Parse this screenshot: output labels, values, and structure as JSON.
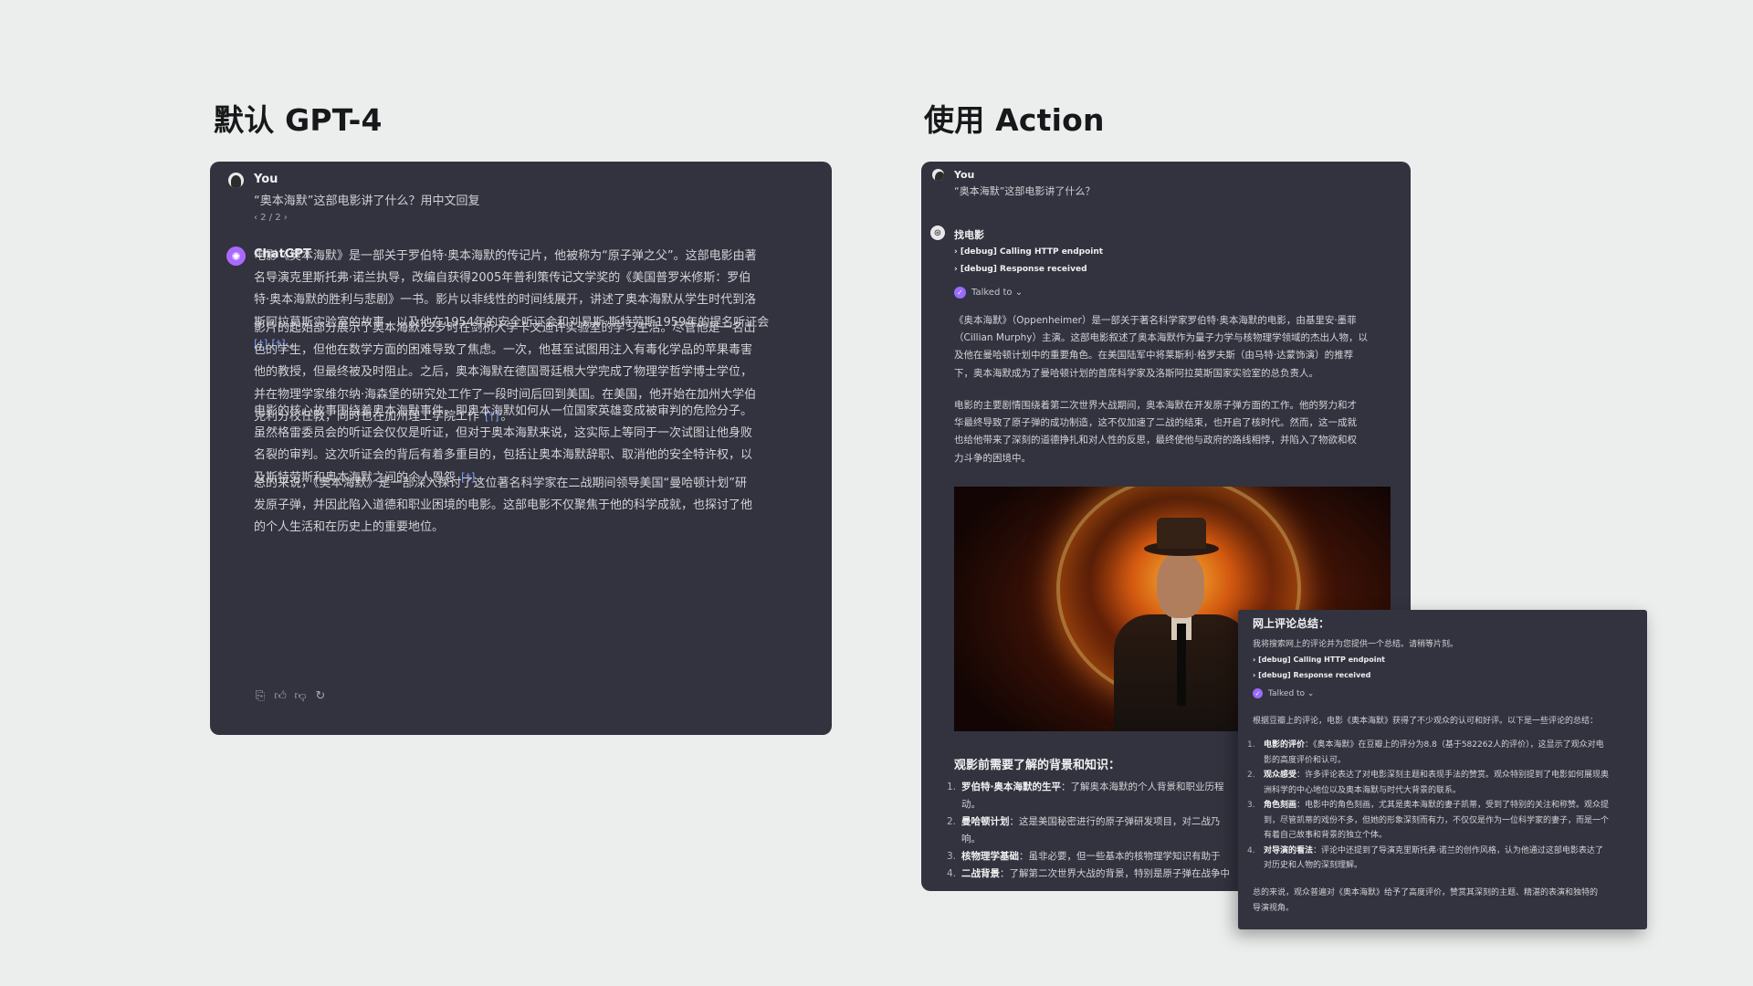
{
  "headings": {
    "left": "默认 GPT-4",
    "right": "使用 Action"
  },
  "left_panel": {
    "user_name": "You",
    "user_message": "“奥本海默”这部电影讲了什么？用中文回复",
    "pager": "‹ 2 / 2 ›",
    "assistant_name": "ChatGPT",
    "paragraphs": [
      {
        "lines": [
          "电影《奥本海默》是一部关于罗伯特·奥本海默的传记片，他被称为“原子弹之父”。这部电影由著",
          "名导演克里斯托弗·诺兰执导，改编自获得2005年普利策传记文学奖的《美国普罗米修斯：罗伯",
          "特·奥本海默的胜利与悲剧》一书。影片以非线性的时间线展开，讲述了奥本海默从学生时代到洛",
          "斯阿拉莫斯实验室的故事，以及他在1954年的安全听证会和刘易斯·斯特劳斯1959年的提名听证会"
        ],
        "last": "。",
        "cites": [
          "[†]",
          "[†]"
        ]
      },
      {
        "lines": [
          "影片的起始部分展示了奥本海默22岁时在剑桥大学卡文迪许实验室的学习生活。尽管他是一名出",
          "色的学生，但他在数学方面的困难导致了焦虑。一次，他甚至试图用注入有毒化学品的苹果毒害",
          "他的教授，但最终被及时阻止。之后，奥本海默在德国哥廷根大学完成了物理学哲学博士学位，",
          "并在物理学家维尔纳·海森堡的研究处工作了一段时间后回到美国。在美国，他开始在加州大学伯"
        ],
        "last": "克利分校任教，同时也在加州理工学院工作",
        "end": "。",
        "cites": [
          "[†]"
        ]
      },
      {
        "lines": [
          "电影的核心故事围绕着奥本海默事件，即奥本海默如何从一位国家英雄变成被审判的危险分子。",
          "虽然格雷委员会的听证会仅仅是听证，但对于奥本海默来说，这实际上等同于一次试图让他身败",
          "名裂的审判。这次听证会的背后有着多重目的，包括让奥本海默辞职、取消他的安全特许权，以"
        ],
        "last": "及斯特劳斯和奥本海默之间的个人恩怨",
        "end": "。",
        "cites": [
          "[†]"
        ]
      },
      {
        "lines": [
          "总的来说，《奥本海默》是一部深入探讨了这位著名科学家在二战期间领导美国“曼哈顿计划”研",
          "发原子弹，并因此陷入道德和职业困境的电影。这部电影不仅聚焦于他的科学成就，也探讨了他"
        ],
        "last": "的个人生活和在历史上的重要地位。",
        "end": "",
        "cites": []
      }
    ],
    "action_icons": [
      "copy-icon",
      "thumbs-up-icon",
      "thumbs-down-icon",
      "regenerate-icon"
    ]
  },
  "right_panel": {
    "user_name": "You",
    "user_message": "“奥本海默”这部电影讲了什么？",
    "gpt_name": "找电影",
    "debug_lines": [
      "› [debug] Calling HTTP endpoint",
      "› [debug] Response received"
    ],
    "talked_to": "Talked to ⌄",
    "paragraphs": [
      [
        "《奥本海默》（Oppenheimer）是一部关于著名科学家罗伯特·奥本海默的电影，由基里安·墨菲",
        "（Cillian Murphy）主演。这部电影叙述了奥本海默作为量子力学与核物理学领域的杰出人物，以",
        "及他在曼哈顿计划中的重要角色。在美国陆军中将莱斯利·格罗夫斯（由马特·达蒙饰演）的推荐",
        "下，奥本海默成为了曼哈顿计划的首席科学家及洛斯阿拉莫斯国家实验室的总负责人。"
      ],
      [
        "电影的主要剧情围绕着第二次世界大战期间，奥本海默在开发原子弹方面的工作。他的努力和才",
        "华最终导致了原子弹的成功制造，这不仅加速了二战的结束，也开启了核时代。然而，这一成就",
        "也给他带来了深刻的道德挣扎和对人性的反思，最终使他与政府的路线相悖，并陷入了物欲和权",
        "力斗争的困境中。"
      ]
    ],
    "section_title": "观影前需要了解的背景和知识：",
    "list": [
      {
        "num": "1.",
        "title": "罗伯特·奥本海默的生平",
        "lines": [
          "：了解奥本海默的个人背景和职业历程",
          "动。"
        ]
      },
      {
        "num": "2.",
        "title": "曼哈顿计划",
        "lines": [
          "：这是美国秘密进行的原子弹研发项目，对二战乃",
          "响。"
        ]
      },
      {
        "num": "3.",
        "title": "核物理学基础",
        "lines": [
          "：虽非必要，但一些基本的核物理学知识有助于"
        ]
      },
      {
        "num": "4.",
        "title": "二战背景",
        "lines": [
          "：了解第二次世界大战的背景，特别是原子弹在战争中"
        ]
      }
    ]
  },
  "overlay": {
    "title": "网上评论总结：",
    "intro": "我将搜索网上的评论并为您提供一个总结。请稍等片刻。",
    "debug_lines": [
      "› [debug] Calling HTTP endpoint",
      "› [debug] Response received"
    ],
    "talked_to": "Talked to ⌄",
    "summary_intro": "根据豆瓣上的评论，电影《奥本海默》获得了不少观众的认可和好评。以下是一些评论的总结：",
    "items": [
      {
        "num": "1.",
        "title": "电影的评价",
        "lines": [
          "：《奥本海默》在豆瓣上的评分为8.8（基于582262人的评价），这显示了观众对电",
          "影的高度评价和认可。"
        ]
      },
      {
        "num": "2.",
        "title": "观众感受",
        "lines": [
          "：许多评论表达了对电影深刻主题和表现手法的赞赏。观众特别提到了电影如何展现奥",
          "洲科学的中心地位以及奥本海默与时代大背景的联系。"
        ]
      },
      {
        "num": "3.",
        "title": "角色刻画",
        "lines": [
          "：电影中的角色刻画，尤其是奥本海默的妻子凯蒂，受到了特别的关注和称赞。观众提",
          "到，尽管凯蒂的戏份不多，但她的形象深刻而有力，不仅仅是作为一位科学家的妻子，而是一个",
          "有着自己故事和背景的独立个体。"
        ]
      },
      {
        "num": "4.",
        "title": "对导演的看法",
        "lines": [
          "：评论中还提到了导演克里斯托弗·诺兰的创作风格，认为他通过这部电影表达了",
          "对历史和人物的深刻理解。"
        ]
      }
    ],
    "conclusion": [
      "总的来说，观众普遍对《奥本海默》给予了高度评价，赞赏其深刻的主题、精湛的表演和独特的",
      "导演视角。"
    ]
  },
  "colors": {
    "panel": "#32333e",
    "background": "#eceeed",
    "accent": "#ab68ff",
    "cite": "#7f9cf5"
  }
}
